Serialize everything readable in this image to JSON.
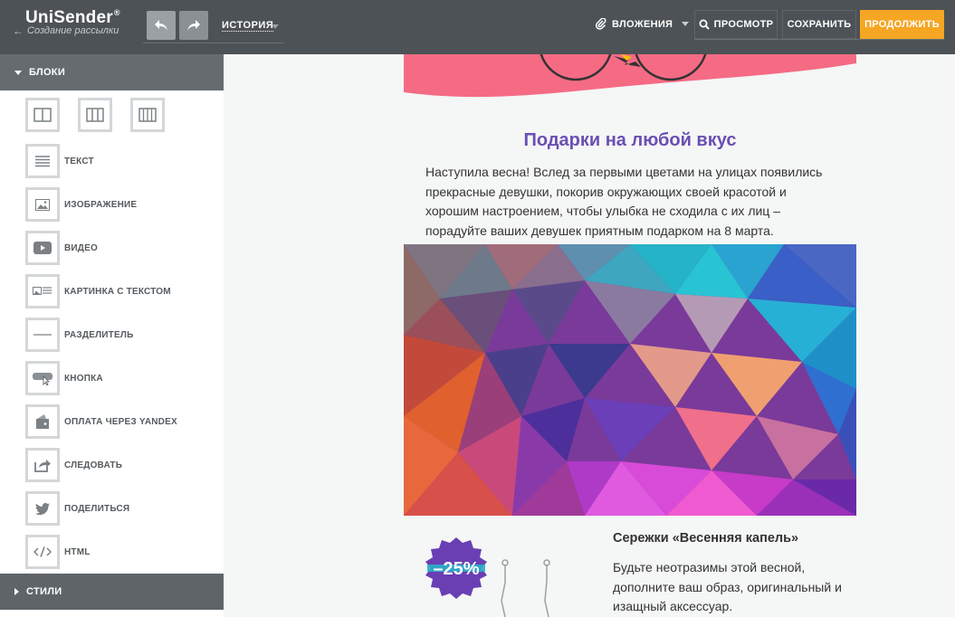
{
  "header": {
    "logo": "UniSender",
    "logo_mark": "®",
    "back_label": "Создание рассылки",
    "history_label": "ИСТОРИЯ",
    "attachments_label": "ВЛОЖЕНИЯ",
    "preview_label": "ПРОСМОТР",
    "save_label": "СОХРАНИТЬ",
    "continue_label": "ПРОДОЛЖИТЬ",
    "continue_color": "#f5a623"
  },
  "sidebar": {
    "blocks_title": "БЛОКИ",
    "styles_title": "СТИЛИ",
    "column_icons": [
      "two-columns-icon",
      "three-columns-icon",
      "four-columns-icon"
    ],
    "items": [
      {
        "label": "ТЕКСТ",
        "icon": "text-icon"
      },
      {
        "label": "ИЗОБРАЖЕНИЕ",
        "icon": "image-icon"
      },
      {
        "label": "ВИДЕО",
        "icon": "video-icon"
      },
      {
        "label": "КАРТИНКА С ТЕКСТОМ",
        "icon": "image-with-text-icon"
      },
      {
        "label": "РАЗДЕЛИТЕЛЬ",
        "icon": "divider-icon"
      },
      {
        "label": "КНОПКА",
        "icon": "button-icon"
      },
      {
        "label": "ОПЛАТА ЧЕРЕЗ YANDEX",
        "icon": "wallet-icon"
      },
      {
        "label": "СЛЕДОВАТЬ",
        "icon": "share-icon"
      },
      {
        "label": "ПОДЕЛИТЬСЯ",
        "icon": "twitter-icon"
      },
      {
        "label": "HTML",
        "icon": "code-icon"
      }
    ]
  },
  "email": {
    "heading": "Подарки на любой вкус",
    "heading_color": "#6a4fb3",
    "intro": "Наступила весна! Вслед за первыми цветами на улицах появились прекрасные девушки, покорив окружающих своей красотой и хорошим настроением, чтобы улыбка не сходила с их лиц – порадуйте ваших девушек приятным подарком на 8 марта.",
    "product_title": "Сережки «Весенняя капель»",
    "product_text": "Будьте неотразимы этой весной, дополните ваш образ, оригинальный и изащный аксессуар.",
    "discount_badge": "–25%"
  }
}
